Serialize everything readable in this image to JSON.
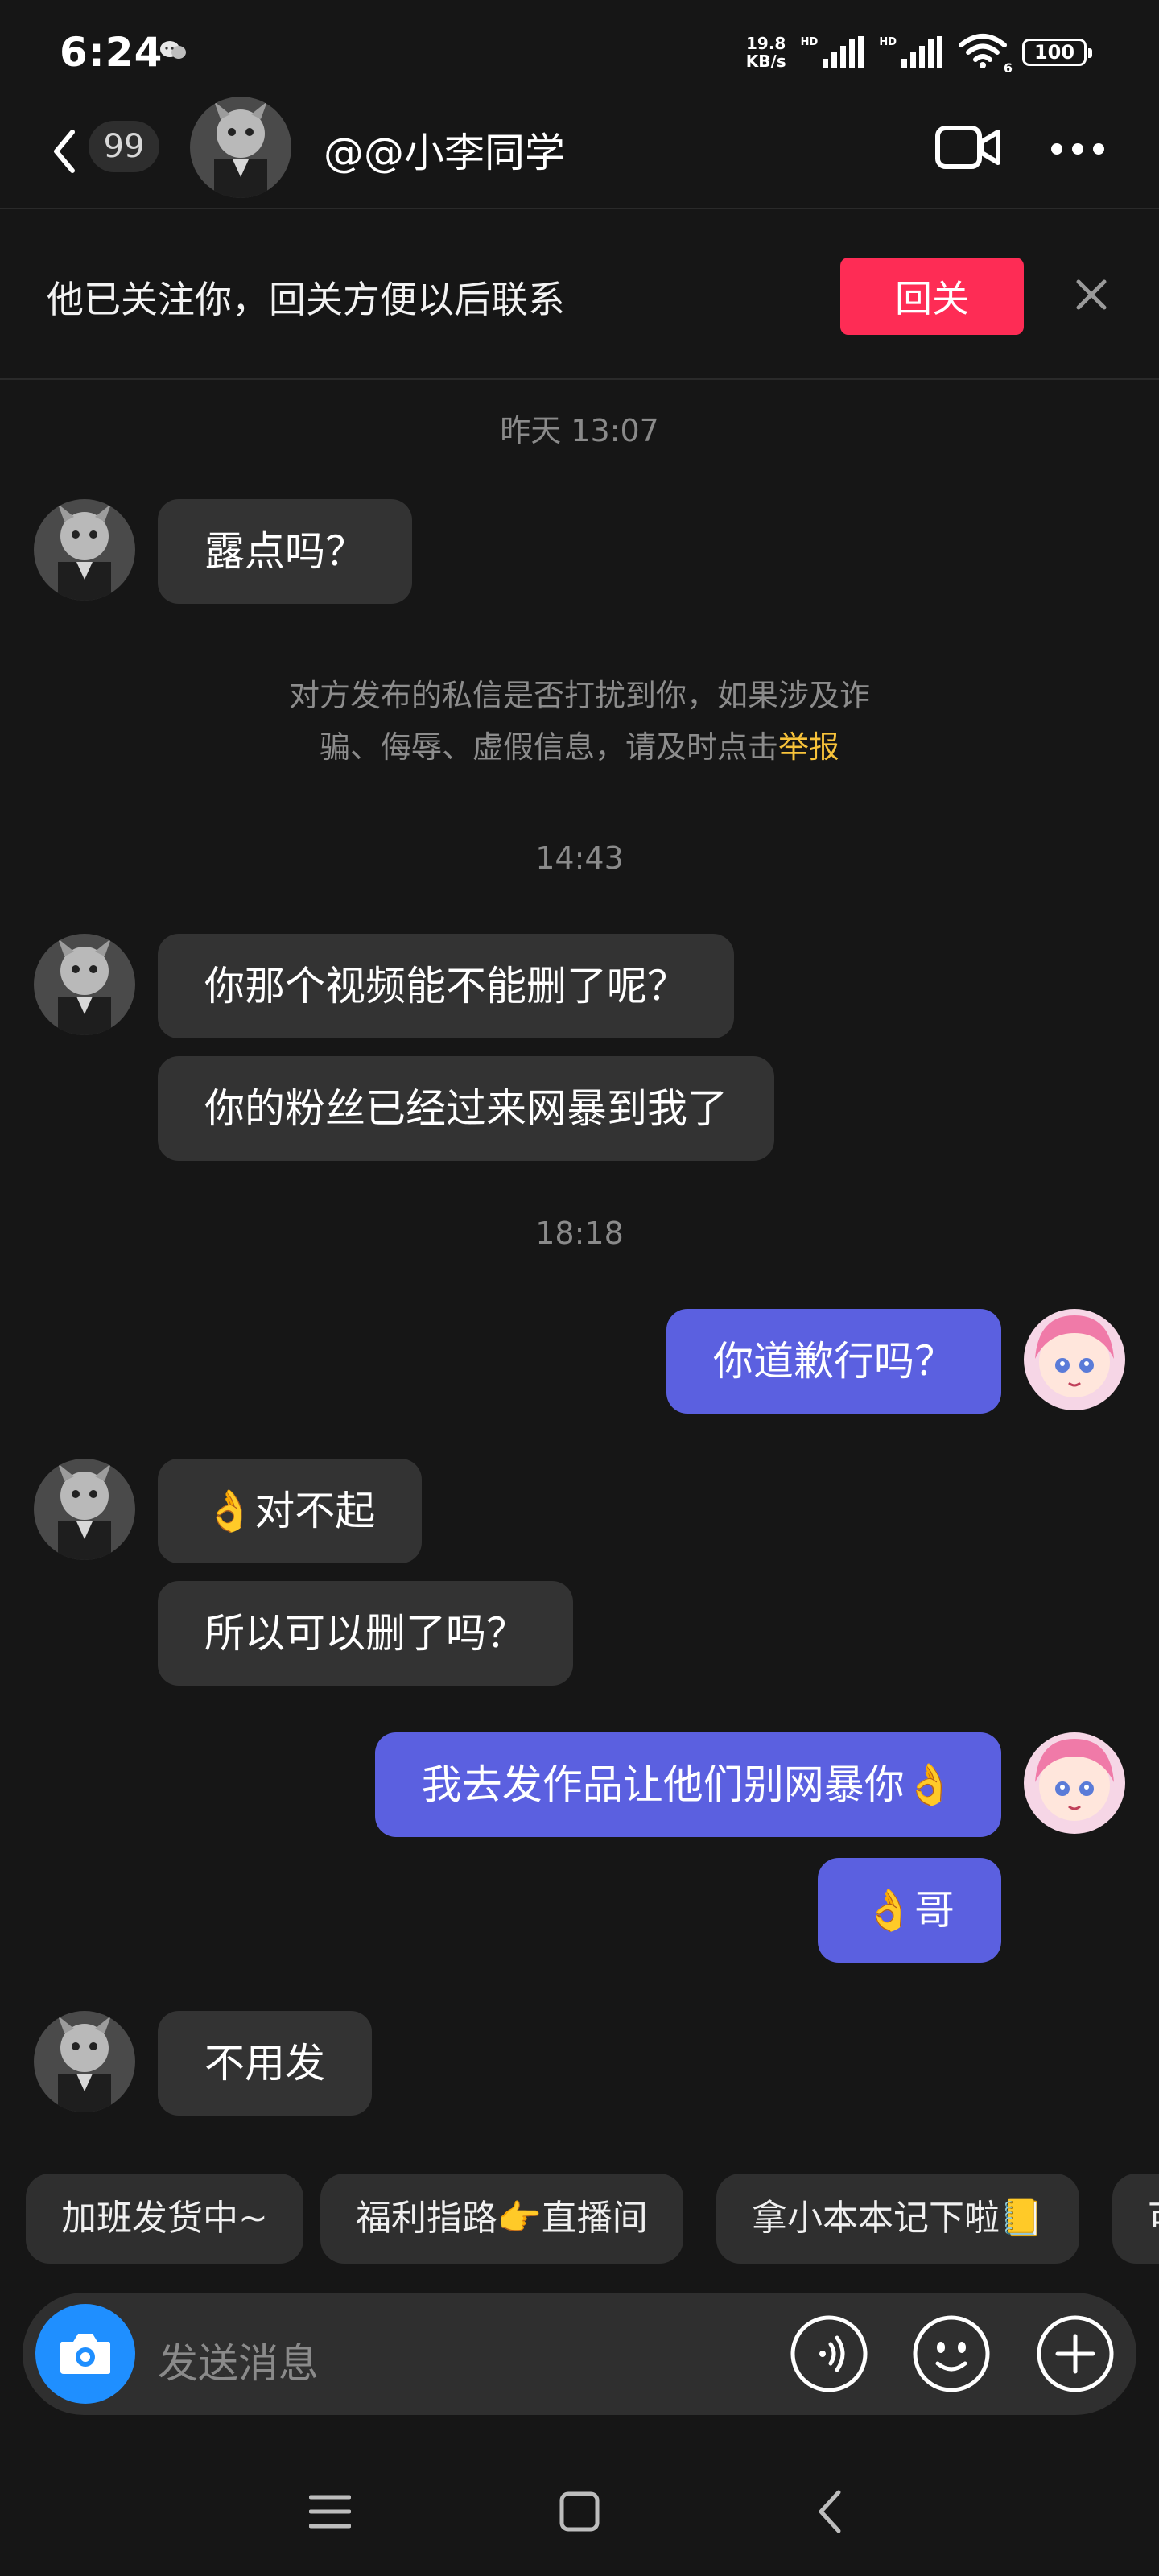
{
  "status_bar": {
    "time": "6:24",
    "net_speed_value": "19.8",
    "net_speed_unit": "KB/s",
    "hd1": "HD",
    "hd2": "HD",
    "wifi_label": "6",
    "battery": "100"
  },
  "header": {
    "unread_count": "99",
    "title": "@@小李同学"
  },
  "follow_banner": {
    "text": "他已关注你，回关方便以后联系",
    "button_label": "回关"
  },
  "timestamps": [
    "昨天 13:07",
    "14:43",
    "18:18"
  ],
  "messages": [
    {
      "side": "in",
      "text": "露点吗？"
    },
    {
      "side": "in",
      "text": "你那个视频能不能删了呢？"
    },
    {
      "side": "in",
      "text": "你的粉丝已经过来网暴到我了"
    },
    {
      "side": "out",
      "text": "你道歉行吗？"
    },
    {
      "side": "in",
      "text": "👌对不起"
    },
    {
      "side": "in",
      "text": "所以可以删了吗？"
    },
    {
      "side": "out",
      "text": "我去发作品让他们别网暴你👌"
    },
    {
      "side": "out",
      "text": "👌哥"
    },
    {
      "side": "in",
      "text": "不用发"
    }
  ],
  "notice": {
    "line1": "对方发布的私信是否打扰到你，如果涉及诈",
    "line2": "骗、侮辱、虚假信息，请及时点击",
    "report_link": "举报"
  },
  "quick_replies": [
    "加班发货中~",
    "福利指路👉直播间",
    "拿小本本记下啦📒",
    "可"
  ],
  "input": {
    "placeholder": "发送消息"
  },
  "colors": {
    "background": "#161616",
    "incoming_bubble": "#333333",
    "outgoing_bubble": "#5b60e0",
    "follow_button": "#fe2c55",
    "report_link": "#f8c33a",
    "camera_button": "#1f8fff"
  },
  "icons": [
    "back-icon",
    "video-call-icon",
    "more-icon",
    "close-icon",
    "camera-icon",
    "voice-icon",
    "emoji-icon",
    "plus-icon",
    "nav-menu-icon",
    "nav-home-icon",
    "nav-back-icon"
  ]
}
